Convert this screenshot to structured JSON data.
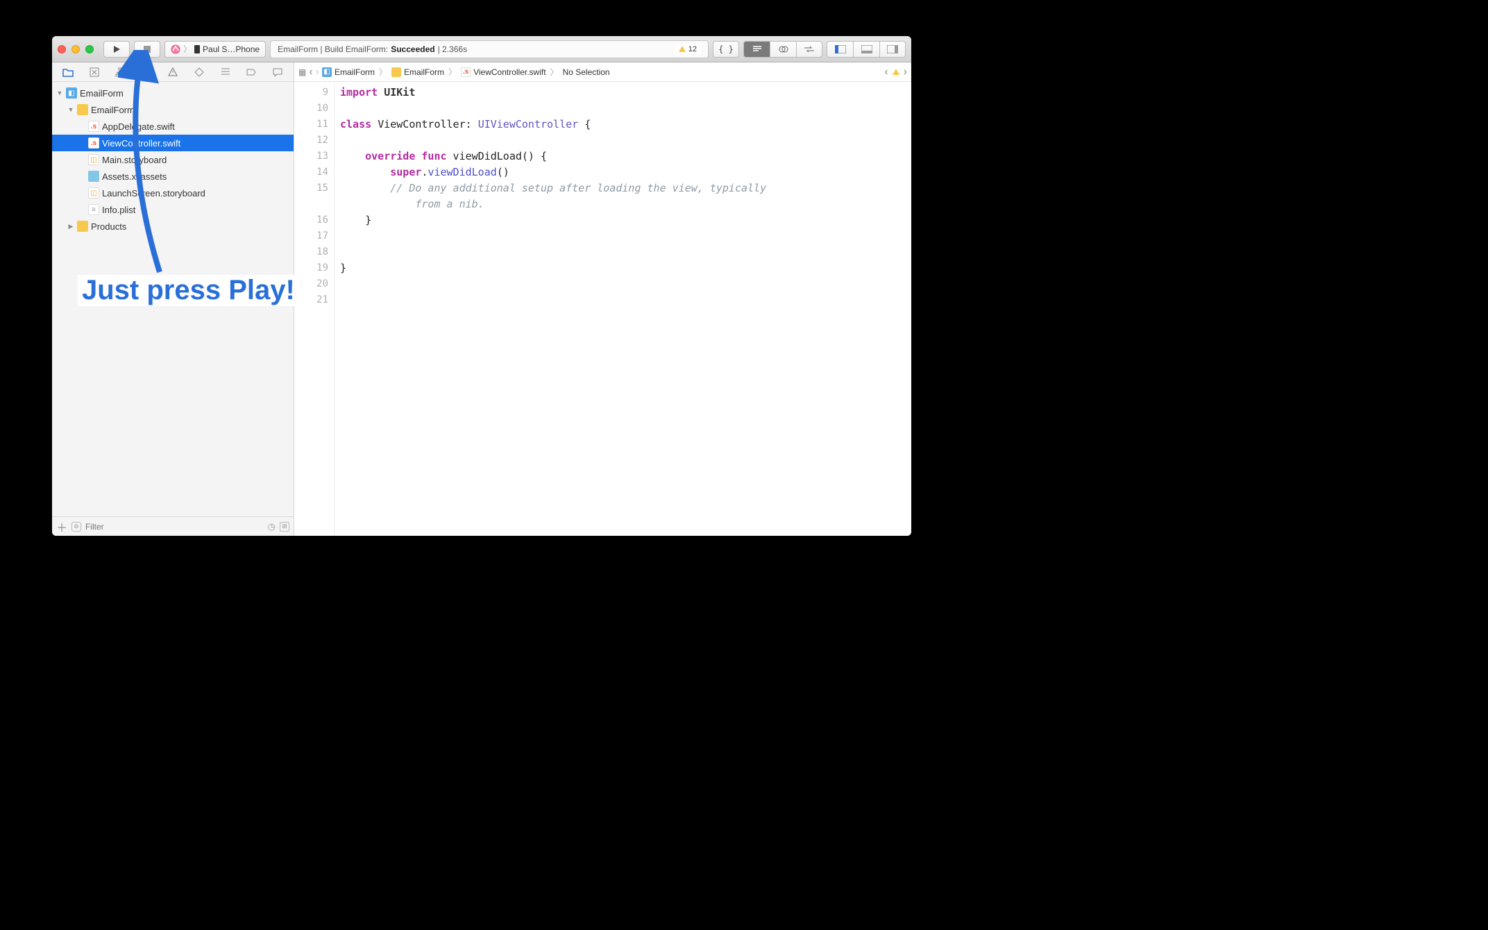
{
  "toolbar": {
    "scheme_label": "Paul S…Phone",
    "activity_prefix": "EmailForm | Build EmailForm: ",
    "activity_status": "Succeeded",
    "activity_suffix": " | 2.366s",
    "warning_count": "12"
  },
  "navigator": {
    "project": "EmailForm",
    "group": "EmailForm",
    "files": {
      "appdelegate": "AppDelegate.swift",
      "viewcontroller": "ViewController.swift",
      "main_sb": "Main.storyboard",
      "assets": "Assets.xcassets",
      "launch_sb": "LaunchScreen.storyboard",
      "info": "Info.plist"
    },
    "products": "Products",
    "filter_placeholder": "Filter"
  },
  "jumpbar": {
    "proj": "EmailForm",
    "group": "EmailForm",
    "file": "ViewController.swift",
    "sel": "No Selection"
  },
  "gutter": {
    "l9": "9",
    "l10": "10",
    "l11": "11",
    "l12": "12",
    "l13": "13",
    "l14": "14",
    "l15": "15",
    "l16": "16",
    "l17": "17",
    "l18": "18",
    "l19": "19",
    "l20": "20",
    "l21": "21"
  },
  "code": {
    "l9_import": "import",
    "l9_uikit": "UIKit",
    "l11_class": "class",
    "l11_name": "ViewController",
    "l11_colon": ": ",
    "l11_super": "UIViewController",
    "l11_brace": " {",
    "l13_override": "override",
    "l13_func": "func",
    "l13_sig": " viewDidLoad() {",
    "l14_super": "super",
    "l14_dot": ".",
    "l14_call": "viewDidLoad",
    "l14_parens": "()",
    "l15_comment1": "// Do any additional setup after loading the view, typically",
    "l15_comment2": "from a nib.",
    "l16_brace": "    }",
    "l19_brace": "}"
  },
  "annotation": {
    "text": "Just press Play!"
  }
}
